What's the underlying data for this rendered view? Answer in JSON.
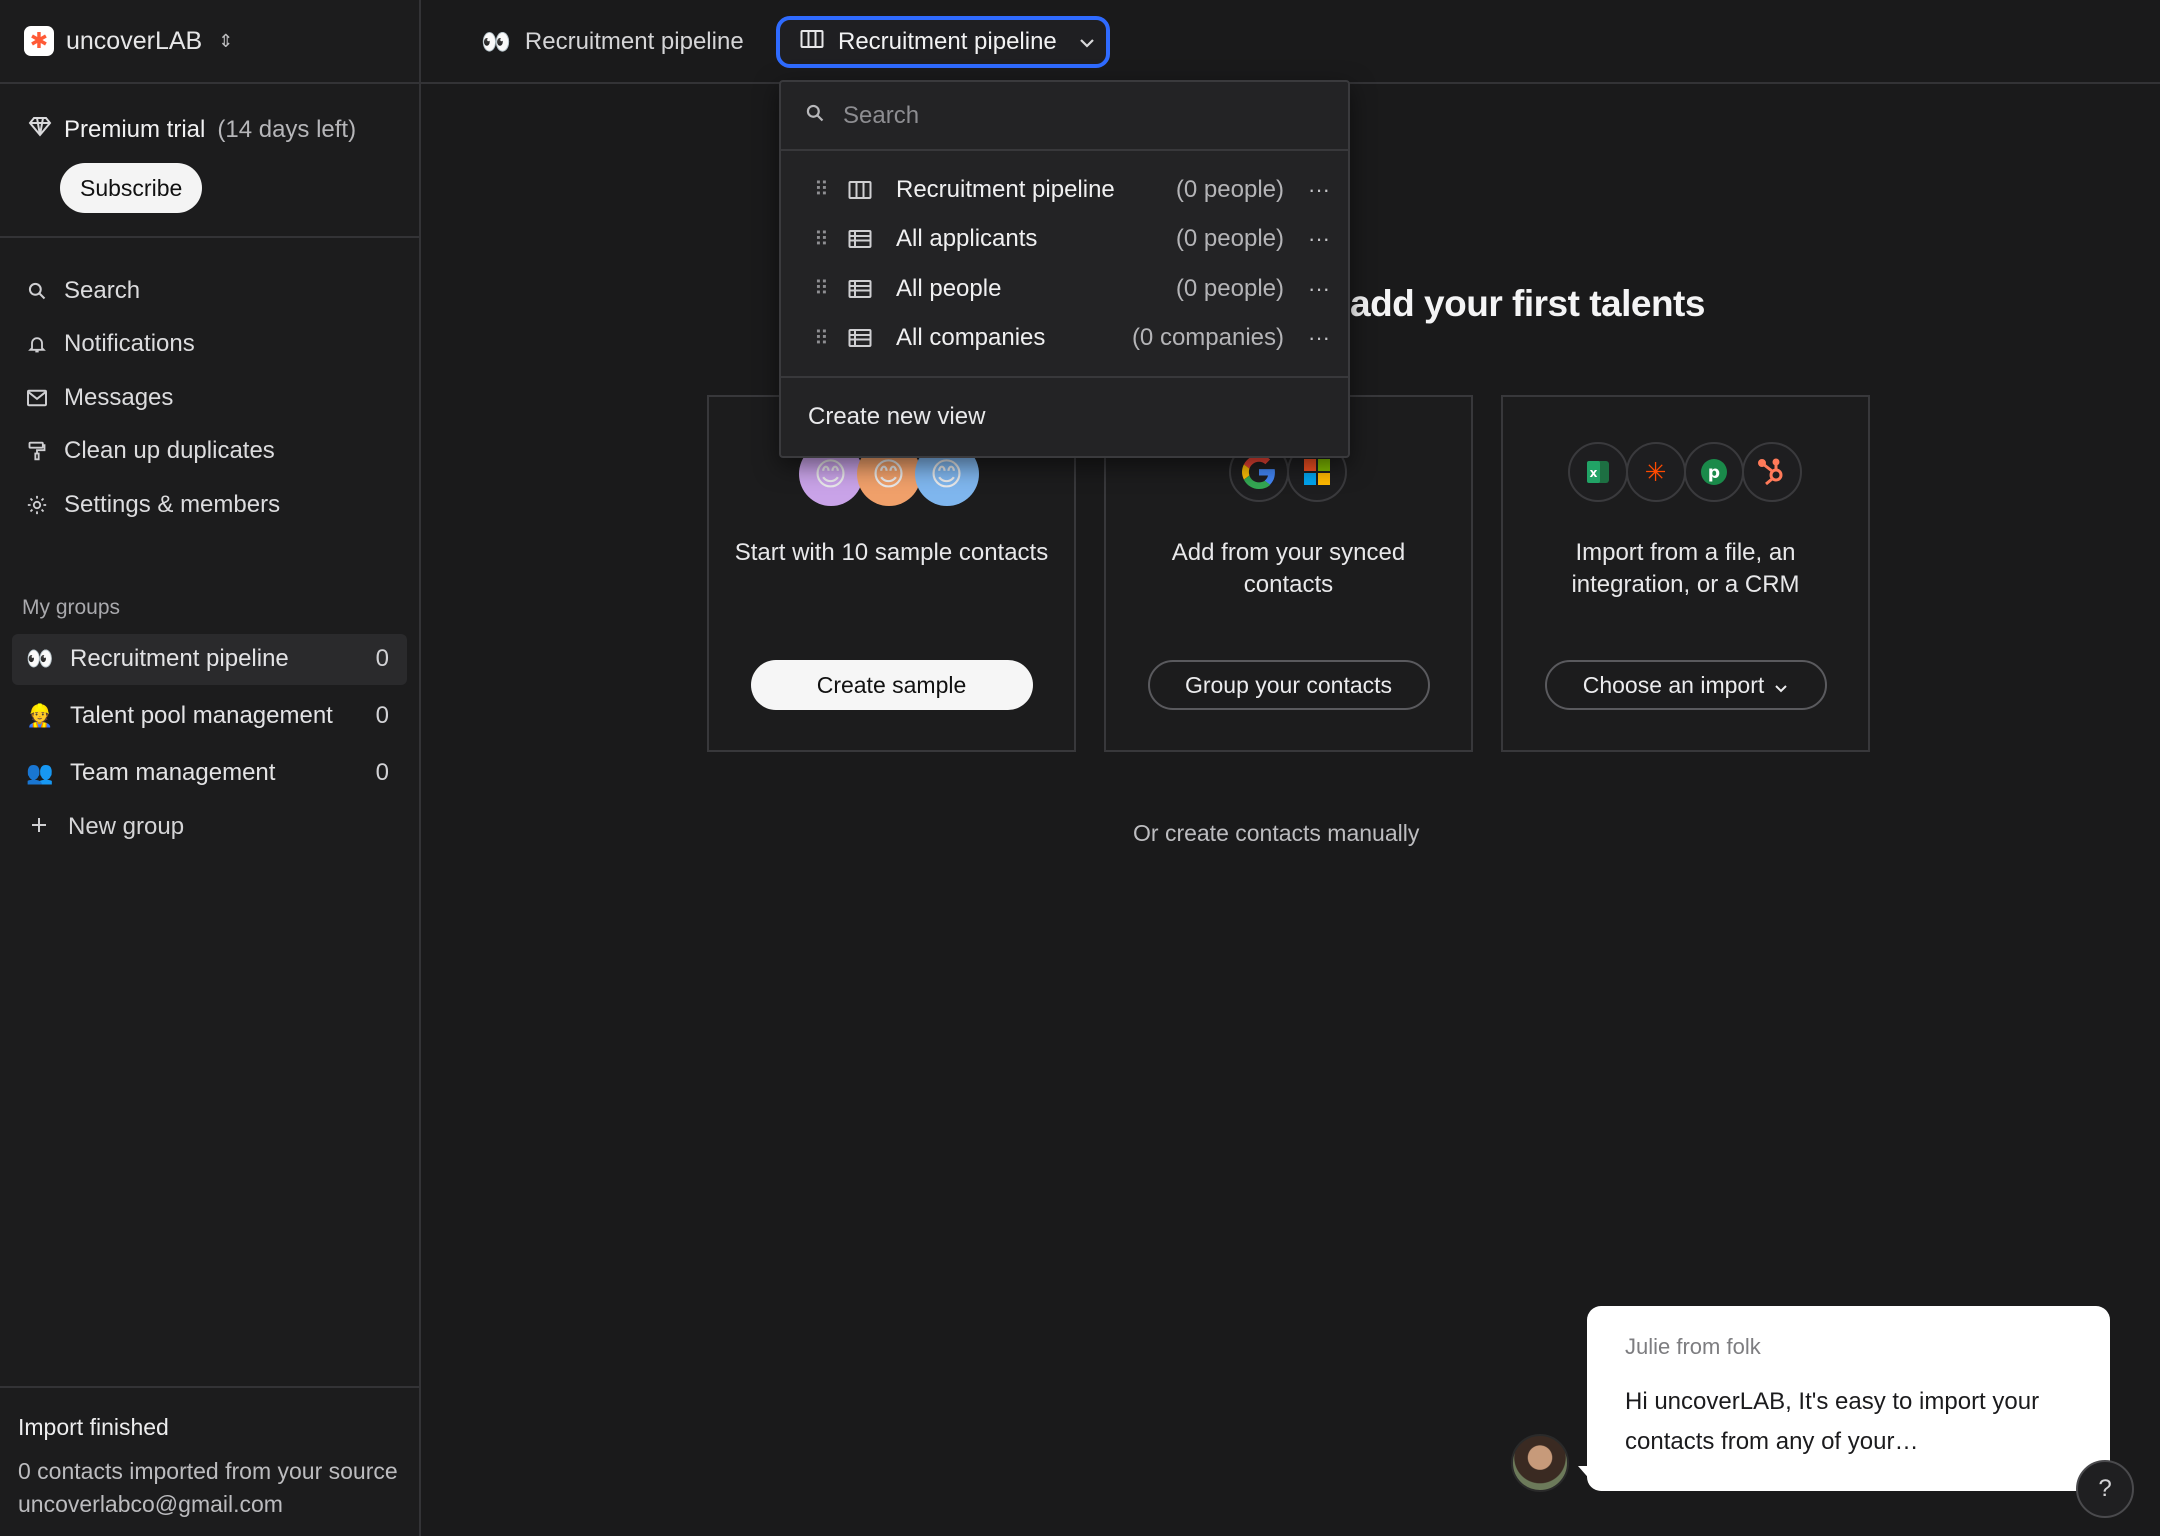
{
  "workspace": {
    "name": "uncoverLAB"
  },
  "trial": {
    "title": "Premium trial",
    "days_left": "(14 days left)",
    "subscribe_label": "Subscribe"
  },
  "nav": {
    "items": [
      {
        "label": "Search",
        "icon": "search-icon"
      },
      {
        "label": "Notifications",
        "icon": "bell-icon"
      },
      {
        "label": "Messages",
        "icon": "envelope-icon"
      },
      {
        "label": "Clean up duplicates",
        "icon": "broom-icon"
      },
      {
        "label": "Settings & members",
        "icon": "gear-icon"
      }
    ]
  },
  "groups": {
    "title": "My groups",
    "items": [
      {
        "emoji": "👀",
        "label": "Recruitment pipeline",
        "count": "0"
      },
      {
        "emoji": "👷",
        "label": "Talent pool management",
        "count": "0"
      },
      {
        "emoji": "👥",
        "label": "Team management",
        "count": "0"
      }
    ],
    "new_label": "New group"
  },
  "import_status": {
    "title": "Import finished",
    "description": "0 contacts imported from your source uncoverlabco@gmail.com"
  },
  "topbar": {
    "crumb": "Recruitment pipeline",
    "crumb_emoji": "👀",
    "view_label": "Recruitment pipeline"
  },
  "dropdown": {
    "search_placeholder": "Search",
    "views": [
      {
        "label": "Recruitment pipeline",
        "count": "(0 people)",
        "icon": "board-icon"
      },
      {
        "label": "All applicants",
        "count": "(0 people)",
        "icon": "table-icon"
      },
      {
        "label": "All people",
        "count": "(0 people)",
        "icon": "table-icon"
      },
      {
        "label": "All companies",
        "count": "(0 companies)",
        "icon": "table-icon"
      }
    ],
    "create_label": "Create new view"
  },
  "main": {
    "title": "add your first talents",
    "cards": [
      {
        "text": "Start with 10 sample contacts",
        "button": "Create sample"
      },
      {
        "text": "Add from your synced contacts",
        "button": "Group your contacts"
      },
      {
        "text": "Import from a file, an integration, or a CRM",
        "button": "Choose an import"
      }
    ],
    "manual_link": "Or create contacts manually"
  },
  "chat": {
    "from": "Julie from folk",
    "message": "Hi uncoverLAB, It's easy to import your contacts from any of your…"
  },
  "colors": {
    "accent": "#2f6bff",
    "background": "#1a1a1b",
    "brand": "#ff5a36"
  }
}
